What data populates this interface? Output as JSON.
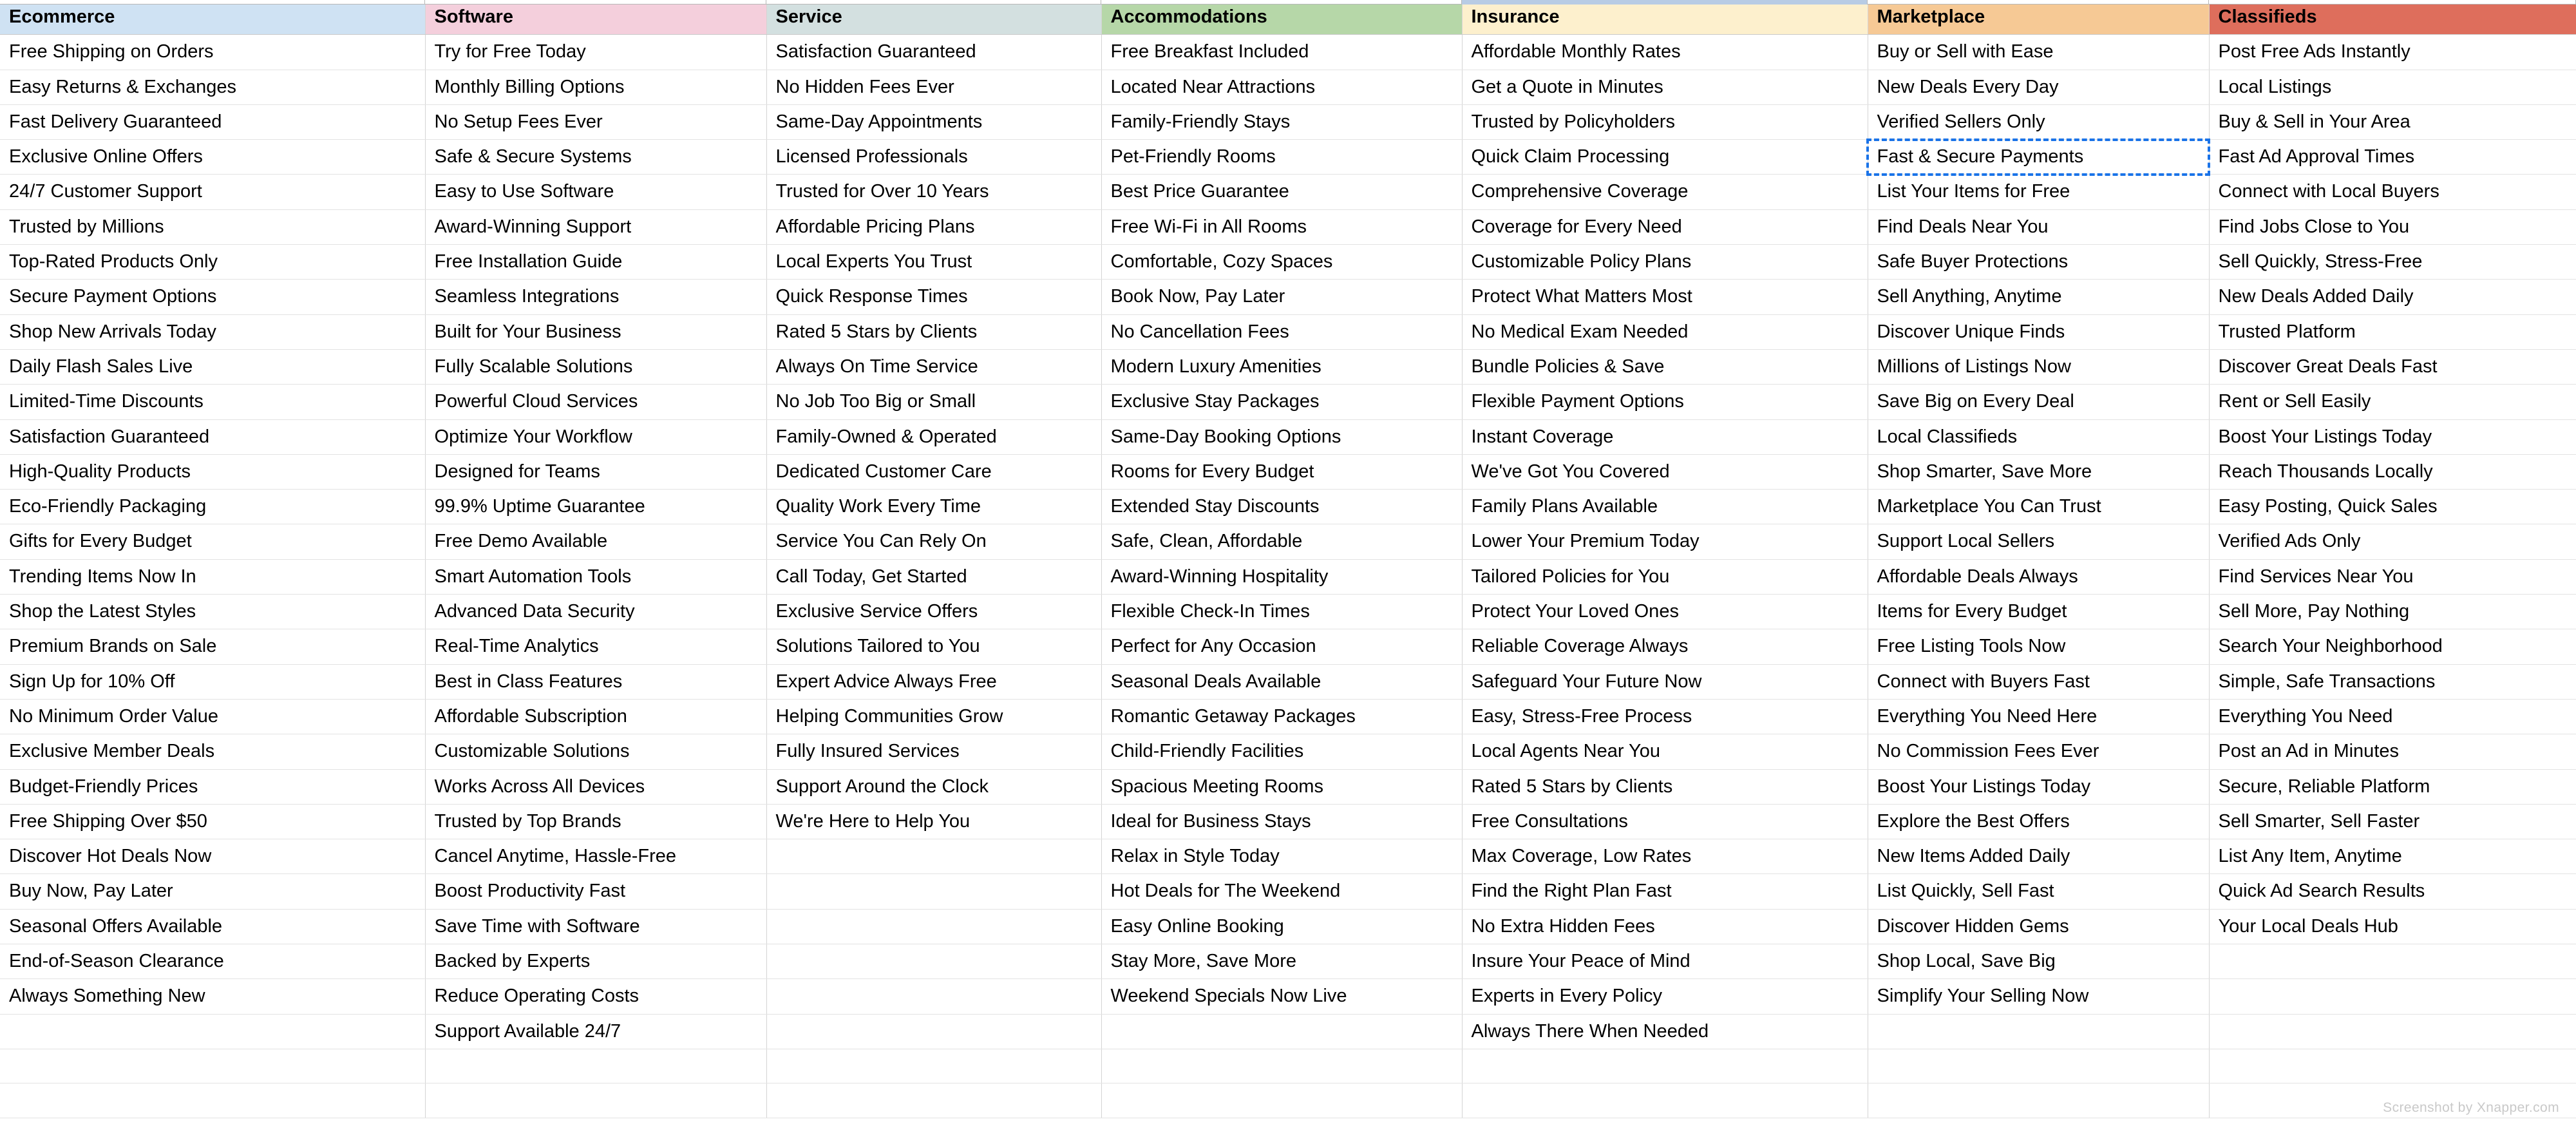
{
  "app": {
    "type": "spreadsheet",
    "watermark": "Screenshot by Xnapper.com"
  },
  "selection": {
    "value": "Verified Sellers Only",
    "column": "Marketplace",
    "row_index": 3,
    "border_color": "#1a73e8",
    "border_style": "dashed"
  },
  "table": {
    "columns": [
      {
        "header": "Ecommerce",
        "header_bg": "#cfe2f3"
      },
      {
        "header": "Software",
        "header_bg": "#f4cfdc"
      },
      {
        "header": "Service",
        "header_bg": "#d3e0e0"
      },
      {
        "header": "Accommodations",
        "header_bg": "#b6d7a8"
      },
      {
        "header": "Insurance",
        "header_bg": "#fdf0cd"
      },
      {
        "header": "Marketplace",
        "header_bg": "#f6c995"
      },
      {
        "header": "Classifieds",
        "header_bg": "#de6e5c"
      }
    ],
    "rows": [
      [
        "Free Shipping on Orders",
        "Try for Free Today",
        "Satisfaction Guaranteed",
        "Free Breakfast Included",
        "Affordable Monthly Rates",
        "Buy or Sell with Ease",
        "Post Free Ads Instantly"
      ],
      [
        "Easy Returns & Exchanges",
        "Monthly Billing Options",
        "No Hidden Fees Ever",
        "Located Near Attractions",
        "Get a Quote in Minutes",
        "New Deals Every Day",
        "Local Listings"
      ],
      [
        "Fast Delivery Guaranteed",
        "No Setup Fees Ever",
        "Same-Day Appointments",
        "Family-Friendly Stays",
        "Trusted by Policyholders",
        "Verified Sellers Only",
        "Buy & Sell in Your Area"
      ],
      [
        "Exclusive Online Offers",
        "Safe & Secure Systems",
        "Licensed Professionals",
        "Pet-Friendly Rooms",
        "Quick Claim Processing",
        "Fast & Secure Payments",
        "Fast Ad Approval Times"
      ],
      [
        "24/7 Customer Support",
        "Easy to Use Software",
        "Trusted for Over 10 Years",
        "Best Price Guarantee",
        "Comprehensive Coverage",
        "List Your Items for Free",
        "Connect with Local Buyers"
      ],
      [
        "Trusted by Millions",
        "Award-Winning Support",
        "Affordable Pricing Plans",
        "Free Wi-Fi in All Rooms",
        "Coverage for Every Need",
        "Find Deals Near You",
        "Find Jobs Close to You"
      ],
      [
        "Top-Rated Products Only",
        "Free Installation Guide",
        "Local Experts You Trust",
        "Comfortable, Cozy Spaces",
        "Customizable Policy Plans",
        "Safe Buyer Protections",
        "Sell Quickly, Stress-Free"
      ],
      [
        "Secure Payment Options",
        "Seamless Integrations",
        "Quick Response Times",
        "Book Now, Pay Later",
        "Protect What Matters Most",
        "Sell Anything, Anytime",
        "New Deals Added Daily"
      ],
      [
        "Shop New Arrivals Today",
        "Built for Your Business",
        "Rated 5 Stars by Clients",
        "No Cancellation Fees",
        "No Medical Exam Needed",
        "Discover Unique Finds",
        "Trusted Platform"
      ],
      [
        "Daily Flash Sales Live",
        "Fully Scalable Solutions",
        "Always On Time Service",
        "Modern Luxury Amenities",
        "Bundle Policies & Save",
        "Millions of Listings Now",
        "Discover Great Deals Fast"
      ],
      [
        "Limited-Time Discounts",
        "Powerful Cloud Services",
        "No Job Too Big or Small",
        "Exclusive Stay Packages",
        "Flexible Payment Options",
        "Save Big on Every Deal",
        "Rent or Sell Easily"
      ],
      [
        "Satisfaction Guaranteed",
        "Optimize Your Workflow",
        "Family-Owned & Operated",
        "Same-Day Booking Options",
        "Instant Coverage",
        "Local Classifieds",
        "Boost Your Listings Today"
      ],
      [
        "High-Quality Products",
        "Designed for Teams",
        "Dedicated Customer Care",
        "Rooms for Every Budget",
        "We've Got You Covered",
        "Shop Smarter, Save More",
        "Reach Thousands Locally"
      ],
      [
        "Eco-Friendly Packaging",
        "99.9% Uptime Guarantee",
        "Quality Work Every Time",
        "Extended Stay Discounts",
        "Family Plans Available",
        "Marketplace You Can Trust",
        "Easy Posting, Quick Sales"
      ],
      [
        "Gifts for Every Budget",
        "Free Demo Available",
        "Service You Can Rely On",
        "Safe, Clean, Affordable",
        "Lower Your Premium Today",
        "Support Local Sellers",
        "Verified Ads Only"
      ],
      [
        "Trending Items Now In",
        "Smart Automation Tools",
        "Call Today, Get Started",
        "Award-Winning Hospitality",
        "Tailored Policies for You",
        "Affordable Deals Always",
        "Find Services Near You"
      ],
      [
        "Shop the Latest Styles",
        "Advanced Data Security",
        "Exclusive Service Offers",
        "Flexible Check-In Times",
        "Protect Your Loved Ones",
        "Items for Every Budget",
        "Sell More, Pay Nothing"
      ],
      [
        "Premium Brands on Sale",
        "Real-Time Analytics",
        "Solutions Tailored to You",
        "Perfect for Any Occasion",
        "Reliable Coverage Always",
        "Free Listing Tools Now",
        "Search Your Neighborhood"
      ],
      [
        "Sign Up for 10% Off",
        "Best in Class Features",
        "Expert Advice Always Free",
        "Seasonal Deals Available",
        "Safeguard Your Future Now",
        "Connect with Buyers Fast",
        "Simple, Safe Transactions"
      ],
      [
        "No Minimum Order Value",
        "Affordable Subscription",
        "Helping Communities Grow",
        "Romantic Getaway Packages",
        "Easy, Stress-Free Process",
        "Everything You Need Here",
        "Everything You Need"
      ],
      [
        "Exclusive Member Deals",
        "Customizable Solutions",
        "Fully Insured Services",
        "Child-Friendly Facilities",
        "Local Agents Near You",
        "No Commission Fees Ever",
        "Post an Ad in Minutes"
      ],
      [
        "Budget-Friendly Prices",
        "Works Across All Devices",
        "Support Around the Clock",
        "Spacious Meeting Rooms",
        "Rated 5 Stars by Clients",
        "Boost Your Listings Today",
        "Secure, Reliable Platform"
      ],
      [
        "Free Shipping Over $50",
        "Trusted by Top Brands",
        "We're Here to Help You",
        "Ideal for Business Stays",
        "Free Consultations",
        "Explore the Best Offers",
        "Sell Smarter, Sell Faster"
      ],
      [
        "Discover Hot Deals Now",
        "Cancel Anytime, Hassle-Free",
        "",
        "Relax in Style Today",
        "Max Coverage, Low Rates",
        "New Items Added Daily",
        "List Any Item, Anytime"
      ],
      [
        "Buy Now, Pay Later",
        "Boost Productivity Fast",
        "",
        "Hot Deals for The Weekend",
        "Find the Right Plan Fast",
        "List Quickly, Sell Fast",
        "Quick Ad Search Results"
      ],
      [
        "Seasonal Offers Available",
        "Save Time with Software",
        "",
        "Easy Online Booking",
        "No Extra Hidden Fees",
        "Discover Hidden Gems",
        "Your Local Deals Hub"
      ],
      [
        "End-of-Season Clearance",
        "Backed by Experts",
        "",
        "Stay More, Save More",
        "Insure Your Peace of Mind",
        "Shop Local, Save Big",
        ""
      ],
      [
        "Always Something New",
        "Reduce Operating Costs",
        "",
        "Weekend Specials Now Live",
        "Experts in Every Policy",
        "Simplify Your Selling Now",
        ""
      ],
      [
        "",
        "Support Available 24/7",
        "",
        "",
        "Always There When Needed",
        "",
        ""
      ],
      [
        "",
        "",
        "",
        "",
        "",
        "",
        ""
      ],
      [
        "",
        "",
        "",
        "",
        "",
        "",
        ""
      ]
    ]
  }
}
